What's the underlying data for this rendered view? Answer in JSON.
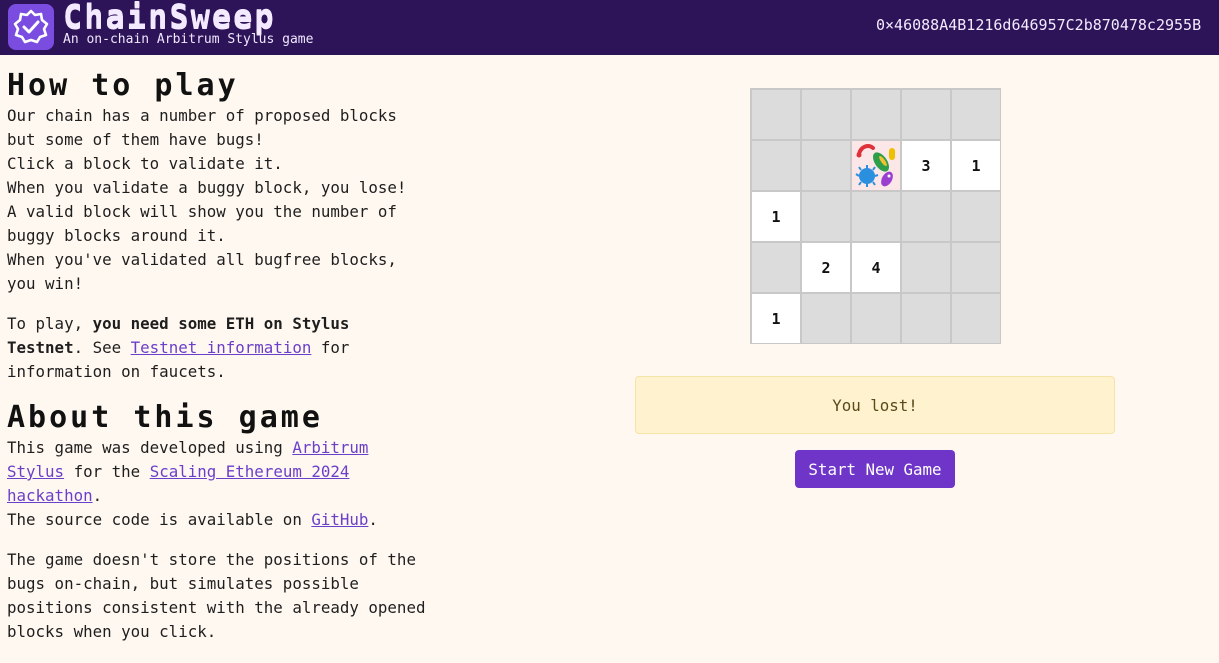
{
  "header": {
    "title": "ChainSweep",
    "subtitle": "An on-chain Arbitrum Stylus game",
    "wallet_address": "0×46088A4B1216d646957C2b870478c2955B"
  },
  "how_to_play": {
    "title": "How to play",
    "lines": [
      "Our chain has a number of proposed blocks",
      "but some of them have bugs!",
      "Click a block to validate it.",
      "When you validate a buggy block, you lose!",
      "A valid block will show you the number of",
      "buggy blocks around it.",
      "When you've validated all bugfree blocks,",
      "you win!"
    ],
    "eth_prefix": "To play, ",
    "eth_bold": "you need some ETH on Stylus Testnet",
    "eth_middle": ". See ",
    "eth_link": "Testnet information",
    "eth_suffix": " for information on faucets."
  },
  "about": {
    "title": "About this game",
    "dev_prefix": "This game was developed using ",
    "dev_link_stylus": "Arbitrum Stylus",
    "dev_middle": " for the ",
    "dev_link_hackathon": "Scaling Ethereum 2024 hackathon",
    "dev_suffix": ".",
    "source_prefix": "The source code is available on ",
    "source_link": "GitHub",
    "source_suffix": ".",
    "storage_text": "The game doesn't store the positions of the bugs on-chain, but simulates possible positions consistent with the already opened blocks when you click."
  },
  "board": {
    "rows": 5,
    "cols": 5,
    "cells": [
      [
        "",
        "",
        "",
        "",
        ""
      ],
      [
        "",
        "",
        "bug",
        "3",
        "1"
      ],
      [
        "1",
        "",
        "",
        "",
        ""
      ],
      [
        "",
        "2",
        "4",
        "",
        ""
      ],
      [
        "1",
        "",
        "",
        "",
        ""
      ]
    ],
    "open": [
      [
        false,
        false,
        false,
        false,
        false
      ],
      [
        false,
        false,
        true,
        true,
        true
      ],
      [
        true,
        false,
        false,
        false,
        false
      ],
      [
        false,
        true,
        true,
        false,
        false
      ],
      [
        true,
        false,
        false,
        false,
        false
      ]
    ]
  },
  "status": {
    "message": "You lost!"
  },
  "actions": {
    "new_game_label": "Start New Game"
  },
  "colors": {
    "header_bg": "#2d1458",
    "accent": "#6f35c9",
    "page_bg": "#fff8f0",
    "cell_closed": "#dcdcdc",
    "message_bg": "#fff2cf"
  }
}
